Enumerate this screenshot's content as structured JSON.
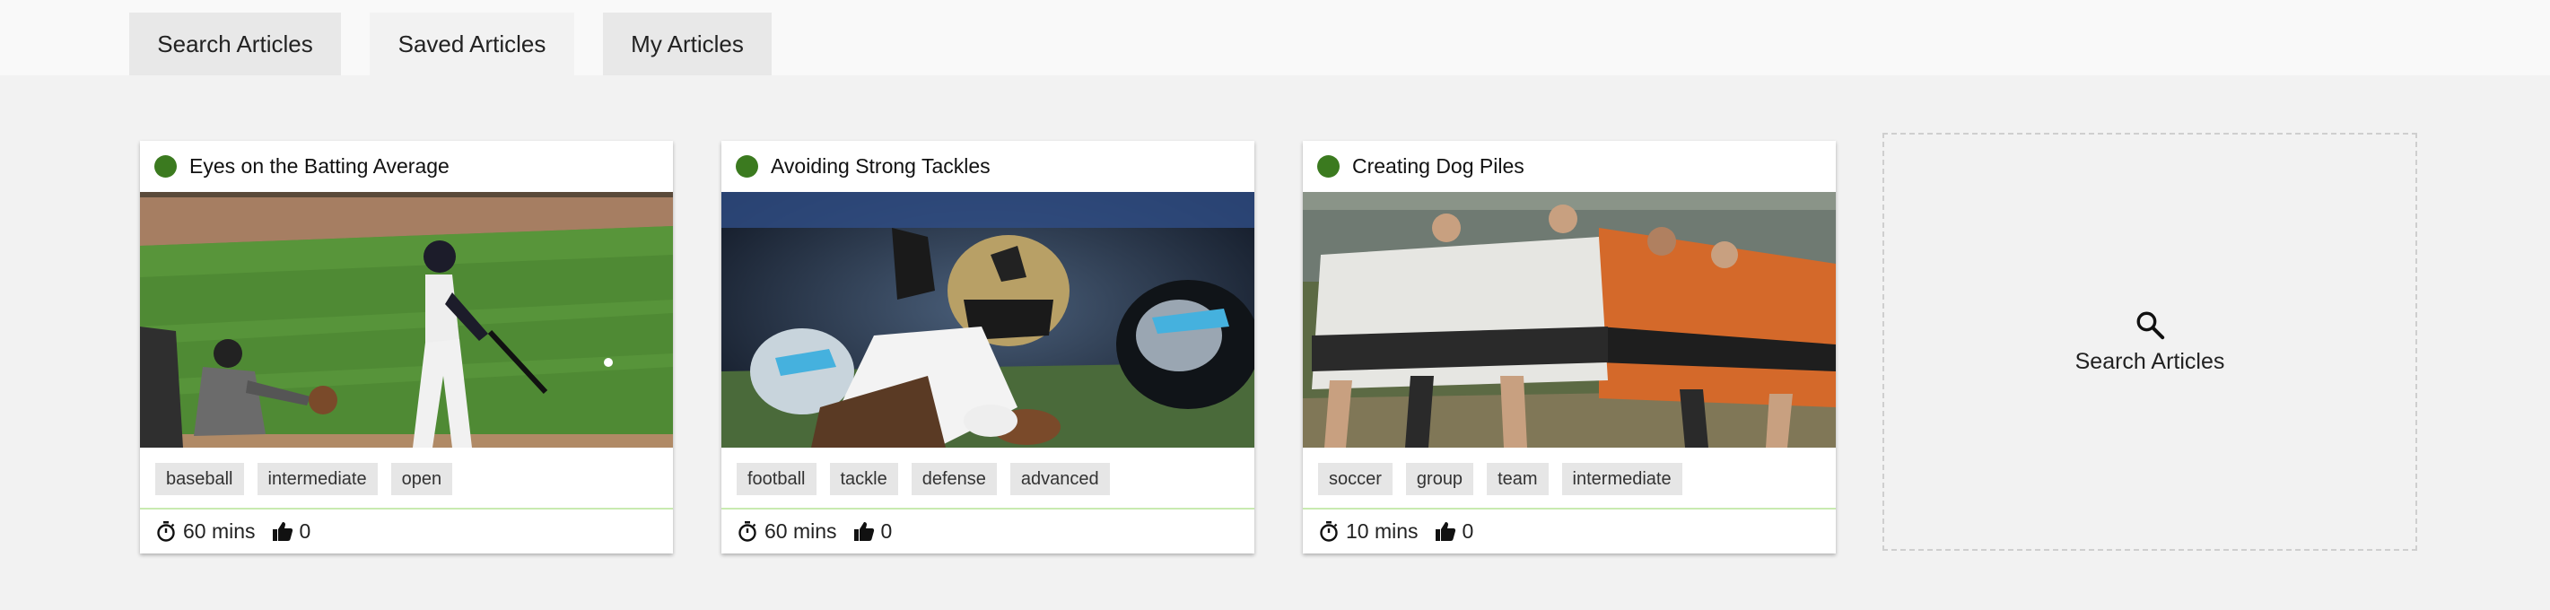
{
  "tabs": [
    {
      "label": "Search Articles",
      "active": false
    },
    {
      "label": "Saved Articles",
      "active": true
    },
    {
      "label": "My Articles",
      "active": false
    }
  ],
  "articles": [
    {
      "title": "Eyes on the Batting Average",
      "status_color": "#3b7a1f",
      "image": "baseball batter swinging, catcher and umpire behind",
      "tags": [
        "baseball",
        "intermediate",
        "open"
      ],
      "duration": "60 mins",
      "likes": "0"
    },
    {
      "title": "Avoiding Strong Tackles",
      "status_color": "#3b7a1f",
      "image": "american football player being tackled",
      "tags": [
        "football",
        "tackle",
        "defense",
        "advanced"
      ],
      "duration": "60 mins",
      "likes": "0"
    },
    {
      "title": "Creating Dog Piles",
      "status_color": "#3b7a1f",
      "image": "rugby scrum",
      "tags": [
        "soccer",
        "group",
        "team",
        "intermediate"
      ],
      "duration": "10 mins",
      "likes": "0"
    }
  ],
  "search_tile": {
    "label": "Search Articles",
    "icon": "search-icon"
  },
  "icons": {
    "duration": "stopwatch-icon",
    "likes": "thumbs-up-icon"
  }
}
